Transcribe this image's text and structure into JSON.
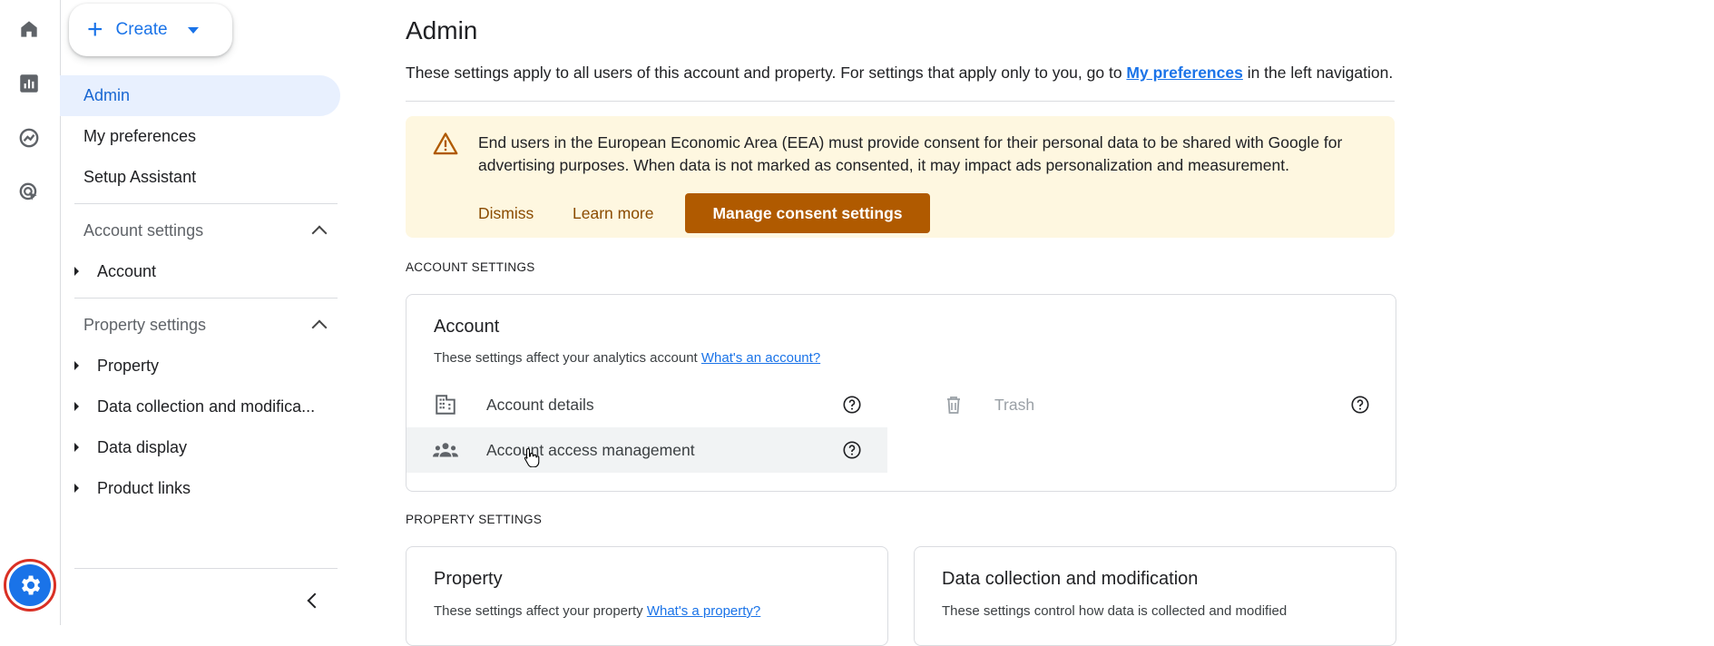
{
  "create_button": {
    "label": "Create"
  },
  "rail": {
    "items": [
      "home-icon",
      "reports-icon",
      "explore-icon",
      "advertising-icon"
    ],
    "admin": "admin-gear-icon"
  },
  "sidebar": {
    "top_items": [
      {
        "label": "Admin",
        "active": true
      },
      {
        "label": "My preferences"
      },
      {
        "label": "Setup Assistant"
      }
    ],
    "account_section": {
      "label": "Account settings",
      "items": [
        "Account"
      ]
    },
    "property_section": {
      "label": "Property settings",
      "items": [
        "Property",
        "Data collection and modifica...",
        "Data display",
        "Product links"
      ]
    }
  },
  "main": {
    "title": "Admin",
    "description_prefix": "These settings apply to all users of this account and property. For settings that apply only to you, go to ",
    "description_link": "My preferences",
    "description_suffix": " in the left navigation.",
    "banner": {
      "message": "End users in the European Economic Area (EEA) must provide consent for their personal data to be shared with Google for advertising purposes. When data is not marked as consented, it may impact ads personalization and measurement.",
      "dismiss": "Dismiss",
      "learn_more": "Learn more",
      "manage": "Manage consent settings"
    },
    "account_settings_label": "ACCOUNT SETTINGS",
    "account_card": {
      "title": "Account",
      "desc": "These settings affect your analytics account ",
      "desc_link": "What's an account?",
      "rows": {
        "details": "Account details",
        "access": "Account access management",
        "trash": "Trash"
      }
    },
    "property_settings_label": "PROPERTY SETTINGS",
    "property_card": {
      "title": "Property",
      "desc": "These settings affect your property ",
      "desc_link": "What's a property?"
    },
    "data_card": {
      "title": "Data collection and modification",
      "desc": "These settings control how data is collected and modified"
    }
  },
  "colors": {
    "accent": "#1a73e8",
    "banner_bg": "#fef7e0",
    "banner_primary": "#b05a00",
    "active_bg": "#e8f0fe"
  }
}
